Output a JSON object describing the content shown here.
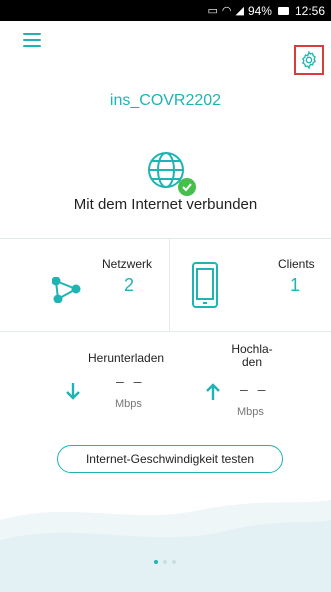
{
  "status_bar": {
    "battery_percent": "94%",
    "time": "12:56"
  },
  "header": {
    "device_name": "ins_COVR2202"
  },
  "connection": {
    "status_text": "Mit dem Internet verbunden"
  },
  "stats": {
    "network_label": "Netzwerk",
    "network_value": "2",
    "clients_label": "Clients",
    "clients_value": "1"
  },
  "speed": {
    "download_label": "Herunterladen",
    "download_value": "– –",
    "download_unit": "Mbps",
    "upload_label": "Hochla-den",
    "upload_value": "– –",
    "upload_unit": "Mbps"
  },
  "actions": {
    "speed_test_label": "Internet-Geschwindigkeit testen"
  },
  "pager": {
    "pages": 3,
    "active_index": 0
  },
  "colors": {
    "accent": "#1fb4b3",
    "success": "#46c04a",
    "highlight": "#d93c3c"
  }
}
